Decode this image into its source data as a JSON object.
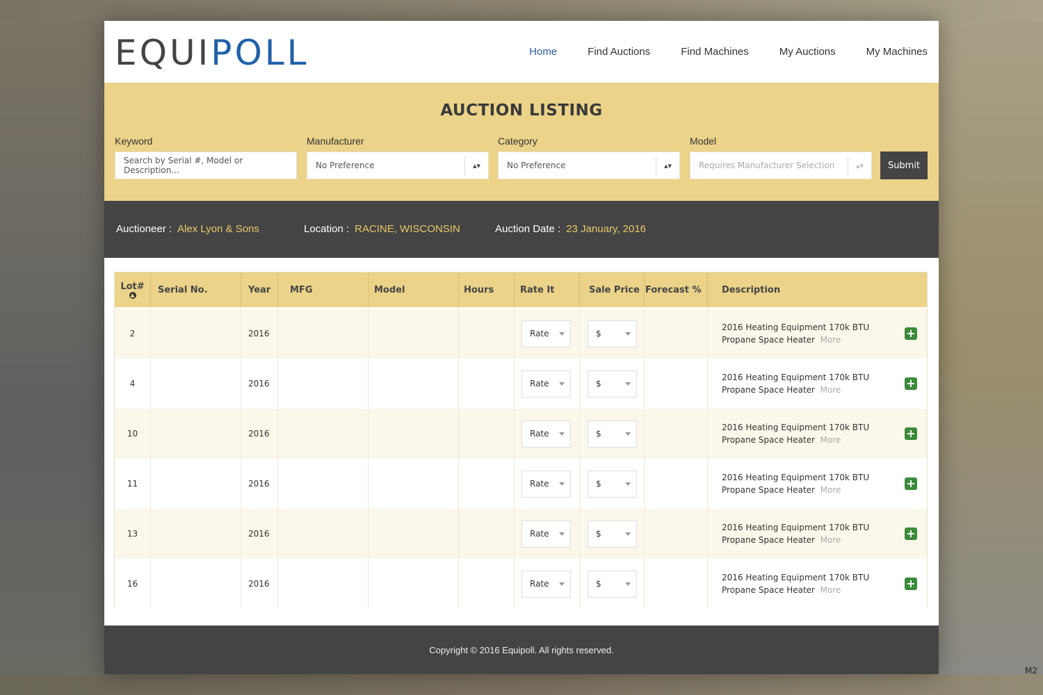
{
  "brand": {
    "logo_dark": "EQUI",
    "logo_blue": "POLL"
  },
  "nav": [
    {
      "label": "Home",
      "active": true
    },
    {
      "label": "Find Auctions",
      "active": false
    },
    {
      "label": "Find Machines",
      "active": false
    },
    {
      "label": "My Auctions",
      "active": false
    },
    {
      "label": "My Machines",
      "active": false
    }
  ],
  "search": {
    "title": "AUCTION LISTING",
    "keyword": {
      "label": "Keyword",
      "placeholder": "Search by Serial #, Model or Description..."
    },
    "manufacturer": {
      "label": "Manufacturer",
      "value": "No Preference"
    },
    "category": {
      "label": "Category",
      "value": "No Preference"
    },
    "model": {
      "label": "Model",
      "placeholder": "Requires Manufacturer Selection"
    },
    "submit_label": "Submit"
  },
  "info": {
    "auctioneer_label": "Auctioneer :",
    "auctioneer": "Alex Lyon & Sons",
    "location_label": "Location :",
    "location": "RACINE, WISCONSIN",
    "date_label": "Auction Date :",
    "date": "23 January, 2016"
  },
  "table": {
    "headers": {
      "lot": "Lot#",
      "serial": "Serial No.",
      "year": "Year",
      "mfg": "MFG",
      "model": "Model",
      "hours": "Hours",
      "rate": "Rate It",
      "sale": "Sale Price",
      "forecast": "Forecast %",
      "description": "Description"
    },
    "rate_label": "Rate",
    "price_label": "$",
    "more_label": "More",
    "rows": [
      {
        "lot": "2",
        "year": "2016",
        "description": "2016 Heating Equipment 170k BTU Propane Space Heater"
      },
      {
        "lot": "4",
        "year": "2016",
        "description": "2016 Heating Equipment 170k BTU Propane Space Heater"
      },
      {
        "lot": "10",
        "year": "2016",
        "description": "2016 Heating Equipment 170k BTU Propane Space Heater"
      },
      {
        "lot": "11",
        "year": "2016",
        "description": "2016 Heating Equipment 170k BTU Propane Space Heater"
      },
      {
        "lot": "13",
        "year": "2016",
        "description": "2016 Heating Equipment 170k BTU Propane Space Heater"
      },
      {
        "lot": "16",
        "year": "2016",
        "description": "2016 Heating Equipment 170k BTU Propane Space Heater"
      }
    ]
  },
  "footer": {
    "text": "Copyright ©  2016  Equipoll.   All rights reserved."
  },
  "corner_tag": "M2",
  "colors": {
    "accent_gold": "#ebd389",
    "dark": "#444444",
    "link_blue": "#2a5c9a",
    "value_gold": "#e8c86a",
    "plus_green": "#3b8a3b"
  }
}
